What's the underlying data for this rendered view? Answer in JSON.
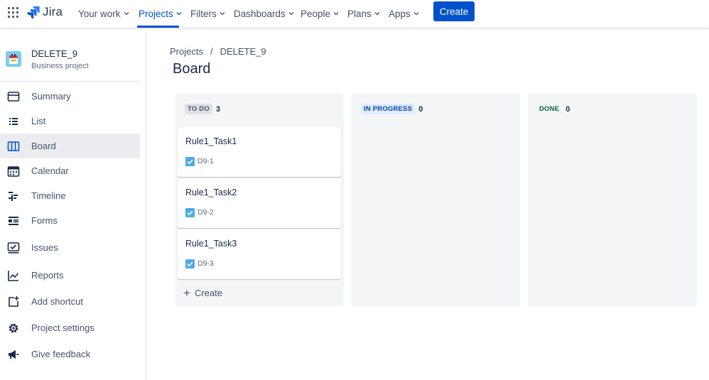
{
  "topnav": {
    "logo_text": "Jira",
    "items": [
      {
        "label": "Your work"
      },
      {
        "label": "Projects"
      },
      {
        "label": "Filters"
      },
      {
        "label": "Dashboards"
      },
      {
        "label": "People"
      },
      {
        "label": "Plans"
      },
      {
        "label": "Apps"
      }
    ],
    "active_item": "Projects",
    "create_label": "Create",
    "accent_color": "#0052cc"
  },
  "sidebar": {
    "project_name": "DELETE_9",
    "project_type": "Business project",
    "items": [
      {
        "label": "Summary",
        "icon": "summary-icon"
      },
      {
        "label": "List",
        "icon": "list-icon"
      },
      {
        "label": "Board",
        "icon": "board-icon"
      },
      {
        "label": "Calendar",
        "icon": "calendar-icon"
      },
      {
        "label": "Timeline",
        "icon": "timeline-icon"
      },
      {
        "label": "Forms",
        "icon": "forms-icon"
      },
      {
        "label": "Issues",
        "icon": "issues-icon"
      },
      {
        "label": "Reports",
        "icon": "reports-icon"
      },
      {
        "label": "Add shortcut",
        "icon": "add-shortcut-icon"
      },
      {
        "label": "Project settings",
        "icon": "gear-icon"
      },
      {
        "label": "Give feedback",
        "icon": "megaphone-icon"
      }
    ],
    "active_item": "Board"
  },
  "main": {
    "breadcrumb": [
      "Projects",
      "DELETE_9"
    ],
    "breadcrumb_separator": "/",
    "title": "Board",
    "columns": [
      {
        "name": "TO DO",
        "count": "3",
        "cards": [
          {
            "title": "Rule1_Task1",
            "key": "D9-1"
          },
          {
            "title": "Rule1_Task2",
            "key": "D9-2"
          },
          {
            "title": "Rule1_Task3",
            "key": "D9-3"
          }
        ],
        "create_label": "Create"
      },
      {
        "name": "IN PROGRESS",
        "count": "0",
        "cards": []
      },
      {
        "name": "DONE",
        "count": "0",
        "cards": []
      }
    ]
  }
}
